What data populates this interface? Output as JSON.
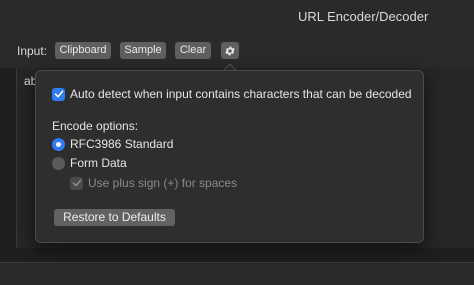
{
  "window": {
    "title": "URL Encoder/Decoder"
  },
  "toolbar": {
    "input_label": "Input:",
    "clipboard_label": "Clipboard",
    "sample_label": "Sample",
    "clear_label": "Clear",
    "settings_icon": "gear-icon"
  },
  "editor": {
    "text": "ab"
  },
  "popover": {
    "auto_detect": {
      "label": "Auto detect when input contains characters that can be decoded",
      "checked": true
    },
    "encode_options_label": "Encode options:",
    "options": [
      {
        "label": "RFC3986 Standard",
        "selected": true
      },
      {
        "label": "Form Data",
        "selected": false
      }
    ],
    "plus_sign": {
      "label": "Use plus sign (+) for spaces",
      "checked": true,
      "disabled": true
    },
    "restore_label": "Restore to Defaults"
  },
  "colors": {
    "accent": "#2f7cf6",
    "background": "#1f1f1f",
    "popover": "#2e2e2e"
  }
}
